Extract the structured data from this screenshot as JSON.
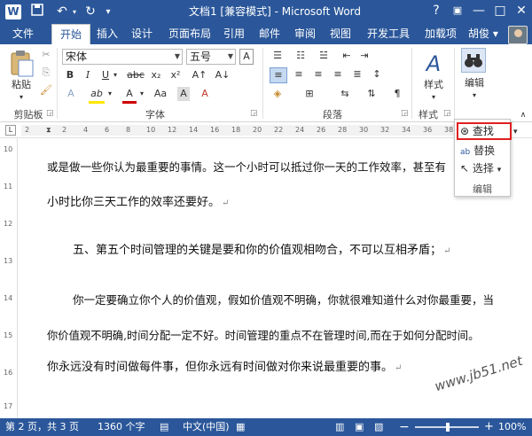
{
  "window": {
    "title": "文档1 [兼容模式] - Microsoft Word",
    "controls": {
      "help": "?",
      "ribbon_options": "▣",
      "minimize": "—",
      "maximize": "□",
      "close": "✕"
    },
    "qat": {
      "save_icon": "save-icon",
      "undo_icon": "undo-icon",
      "redo_icon": "redo-icon",
      "customize_icon": "chevron-down-icon"
    }
  },
  "tabs": {
    "file": "文件",
    "items": [
      "开始",
      "插入",
      "设计",
      "页面布局",
      "引用",
      "邮件",
      "审阅",
      "视图",
      "开发工具",
      "加载项"
    ],
    "user": "胡俊 ▾"
  },
  "ribbon": {
    "clipboard": {
      "paste": "粘贴",
      "paste_arrow": "▾",
      "label": "剪贴板"
    },
    "font": {
      "name": "宋体",
      "size": "五号",
      "label": "字体",
      "bold": "B",
      "italic": "I",
      "underline": "U",
      "strike": "abc",
      "sub": "x₂",
      "sup": "x²",
      "grow": "A↑",
      "shrink": "A↓",
      "case": "Aa",
      "clear": "A",
      "highlight": "ab",
      "color": "A",
      "char_shade": "A",
      "char_border": "A"
    },
    "paragraph": {
      "label": "段落"
    },
    "styles": {
      "name": "样式",
      "label": "样式",
      "arrow": "▾"
    },
    "editing": {
      "name": "编辑",
      "arrow": "▾"
    }
  },
  "editing_dropdown": {
    "find": "查找",
    "replace": "替换",
    "select": "选择",
    "label": "编辑",
    "find_arrow": "▾",
    "select_arrow": "▾"
  },
  "ruler": {
    "tab": "L",
    "numbers": [
      "2",
      "2",
      "4",
      "6",
      "8",
      "10",
      "12",
      "14",
      "16",
      "18",
      "20",
      "22",
      "24",
      "26",
      "28",
      "30",
      "32",
      "34",
      "36",
      "38",
      "40"
    ],
    "vnumbers": [
      "10",
      "11",
      "12",
      "13",
      "14",
      "15",
      "16",
      "17"
    ]
  },
  "document": {
    "paragraphs": [
      "或是做一些你认为最重要的事情。这一个小时可以抵过你一天的工作效率，甚至有",
      "小时比你三天工作的效率还要好。",
      "五、第五个时间管理的关键是要和你的价值观相吻合，不可以互相矛盾；",
      "你一定要确立你个人的价值观，假如价值观不明确，你就很难知道什么对你最重要，当",
      "你价值观不明确,时间分配一定不好。时间管理的重点不在管理时间,而在于如何分配时间。",
      "你永远没有时间做每件事，但你永远有时间做对你来说最重要的事。"
    ],
    "paragraph_mark": "↵"
  },
  "status": {
    "page": "第 2 页，共 3 页",
    "words": "1360 个字",
    "language": "中文(中国)",
    "zoom_minus": "−",
    "zoom_plus": "+",
    "zoom": "100%"
  },
  "watermark": "www.jb51.net"
}
